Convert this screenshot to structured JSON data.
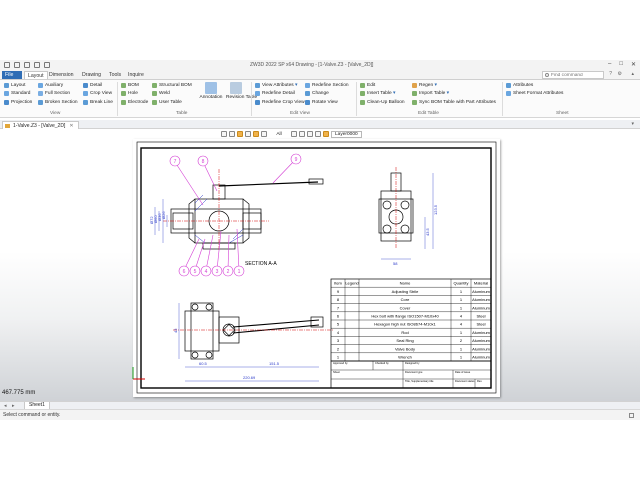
{
  "window": {
    "title": "ZW3D 2022 SP x64        Drawing - [1-Valve.Z3 - [Valve_2D]]"
  },
  "menu": {
    "tabs": [
      "File",
      "Layout",
      "Dimension",
      "Drawing",
      "Tools",
      "Inquire"
    ],
    "active": "Layout",
    "search_placeholder": "Find command"
  },
  "ribbon": {
    "view": {
      "items": [
        "Layout",
        "Standard",
        "Projection",
        "Auxiliary",
        "Full Section",
        "Broken Section",
        "Detail",
        "Crop View",
        "Break Line"
      ],
      "group": "View"
    },
    "table": {
      "items": [
        "BOM",
        "Hole",
        "Electrode",
        "Structural BOM",
        "Weld",
        "User Table"
      ],
      "big": [
        "Annotation",
        "Revision Table"
      ],
      "group": "Table"
    },
    "edit_view": {
      "items": [
        "View Attributes",
        "Redefine Detail",
        "Redefine Crop View",
        "Redefine Section",
        "Change",
        "Rotate View"
      ],
      "group": "Edit View"
    },
    "edit_table": {
      "items": [
        "Edit",
        "Insert Table",
        "Clean-Up Balloon",
        "Regen",
        "Import Table",
        "Sync BOM Table with Part Attributes"
      ],
      "group": "Edit Table"
    },
    "sheet": {
      "items": [
        "Attributes",
        "Sheet Format Attributes"
      ],
      "group": "Sheet"
    }
  },
  "document": {
    "tab": "1-Valve.Z3 - [Valve_2D]"
  },
  "canvas_toolbar": {
    "filter": "All",
    "layer": "Layer0000"
  },
  "measurement": "467.775 mm",
  "sheets": [
    "Sheet1"
  ],
  "status": "Select command or entity.",
  "drawing": {
    "section_label": "SECTION A-A",
    "balloons_top": [
      "7",
      "8",
      "9"
    ],
    "balloons_bottom": [
      "6",
      "5",
      "4",
      "3",
      "2",
      "1"
    ],
    "dims": {
      "front_left": [
        "Ø26",
        "Ø36",
        "Ø60",
        "Ø72"
      ],
      "side_height": [
        "123.5",
        "43.5"
      ],
      "side_width": "58",
      "bottom_width": "220.69",
      "bottom_mid": [
        "60.5",
        "151.5"
      ],
      "bottom_left": "43"
    },
    "bom": {
      "headers": [
        "Item",
        "Legend",
        "Name",
        "Quantity",
        "Material"
      ],
      "rows": [
        [
          "9",
          "",
          "Adjusting Strile",
          "1",
          "Aluminum"
        ],
        [
          "8",
          "",
          "Core",
          "1",
          "Aluminum"
        ],
        [
          "7",
          "",
          "Cover",
          "1",
          "Aluminum"
        ],
        [
          "6",
          "",
          "Hex bolt with flange ISO1507-M10x40",
          "4",
          "Steel"
        ],
        [
          "5",
          "",
          "Hexagon high nut ISO8674-M10x1",
          "4",
          "Steel"
        ],
        [
          "4",
          "",
          "Rod",
          "1",
          "Aluminum"
        ],
        [
          "3",
          "",
          "Seal Ring",
          "2",
          "Aluminum"
        ],
        [
          "2",
          "",
          "Valve Body",
          "1",
          "Aluminum"
        ],
        [
          "1",
          "",
          "Wrench",
          "1",
          "Aluminum"
        ]
      ]
    },
    "title_block": [
      "Approved by",
      "Checked by",
      "Designed by",
      "Document type",
      "Title, Supplementary title",
      "Date of issue",
      "Document status",
      "Rev.",
      "Sheet"
    ]
  },
  "colors": {
    "file_tab": "#2f6db5",
    "drawing_line": "#000000",
    "dim": "#2a39c9",
    "balloon": "#d43fd4",
    "center": "#d40000"
  }
}
